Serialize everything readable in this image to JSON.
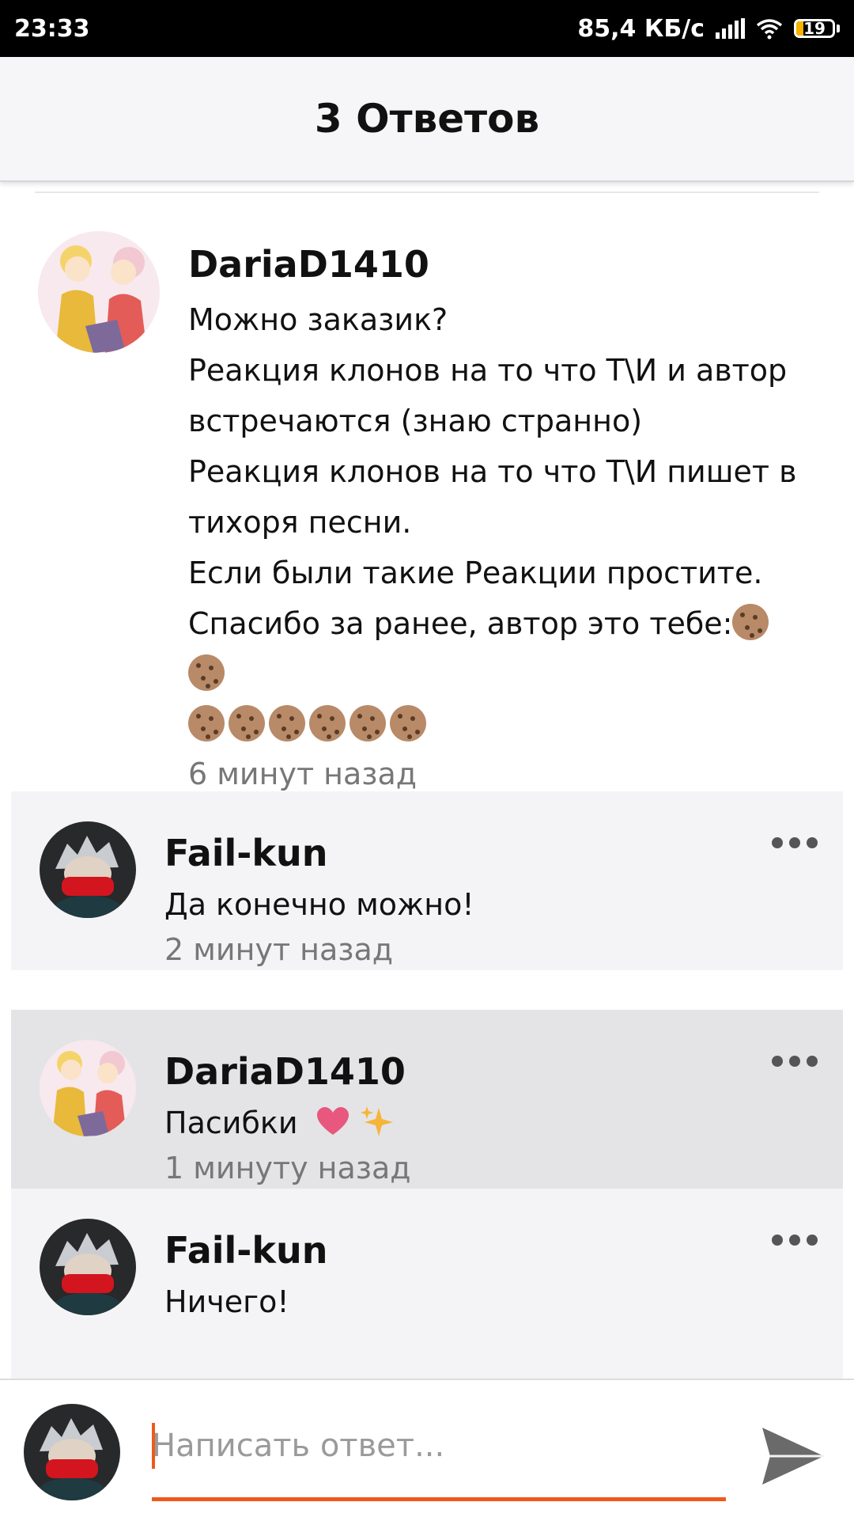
{
  "status_bar": {
    "time": "23:33",
    "speed": "85,4 КБ/с",
    "battery": "19",
    "battery_level": 0.19
  },
  "header": {
    "title": "3 Ответов"
  },
  "main_comment": {
    "author": "DariaD1410",
    "text": "Можно заказик?\nРеакция клонов на то что Т\\И и автор встречаются (знаю странно)\nРеакция клонов на то что Т\\И пишет в тихоря песни.\nЕсли были такие Реакции простите.\nСпасибо за ранее, автор это тебе:",
    "emoji": "cookie x8",
    "time": "6 минут назад"
  },
  "replies": [
    {
      "author": "Fail-kun",
      "text": "Да конечно можно!",
      "time": "2 минут назад"
    },
    {
      "author": "DariaD1410",
      "text": "Пасибки",
      "emoji": "heart, sparkles",
      "time": "1 минуту назад"
    },
    {
      "author": "Fail-kun",
      "text": "Ничего!",
      "time": ""
    }
  ],
  "input": {
    "placeholder": "Написать ответ..."
  },
  "colors": {
    "accent": "#ee5a1c",
    "header_bg": "#f6f6f8",
    "reply_bg": "#f4f4f6",
    "reply_highlight_bg": "#e4e4e6",
    "heart": "#e8577e",
    "sparkle": "#f6b53a"
  },
  "icons": {
    "more": "more-horizontal-icon",
    "send": "send-icon",
    "wifi": "wifi-icon",
    "signal": "signal-icon",
    "battery": "battery-icon",
    "cookie": "cookie-emoji"
  }
}
